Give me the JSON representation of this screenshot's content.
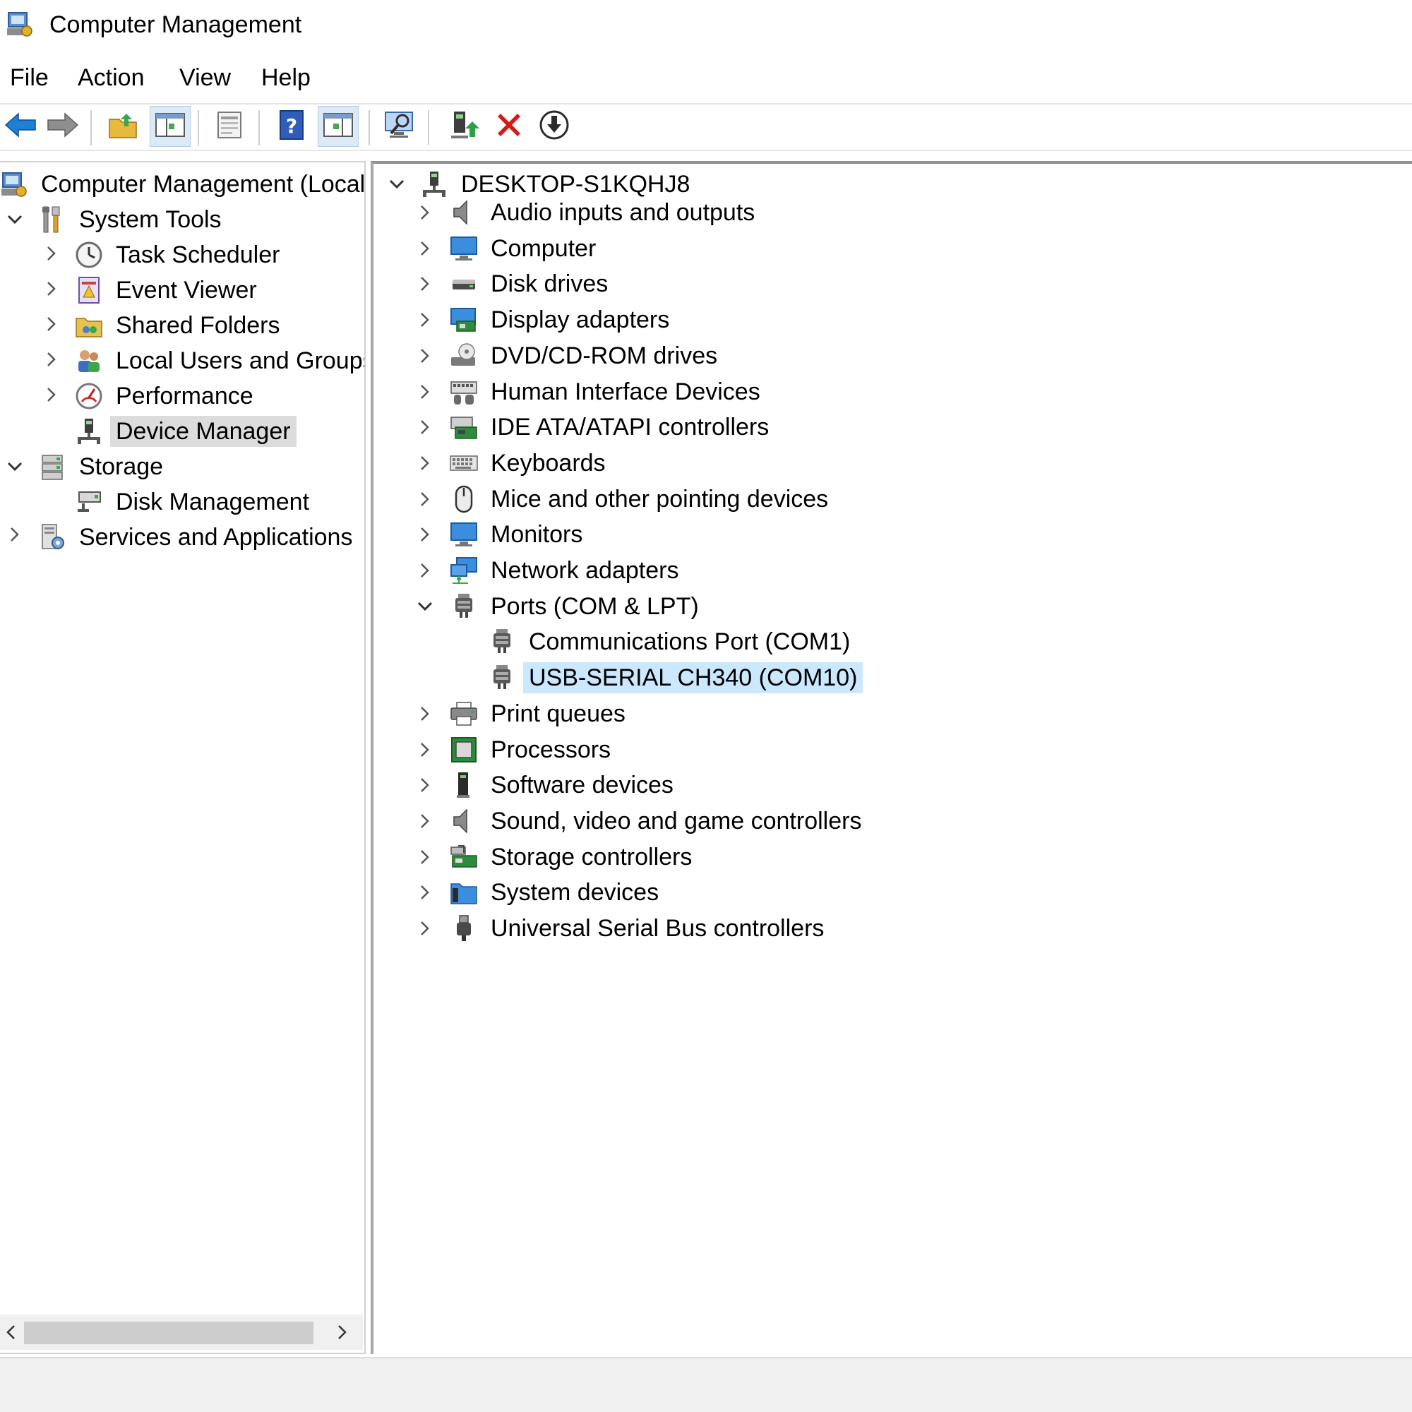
{
  "window": {
    "title": "Computer Management",
    "icon": "computer-management-icon"
  },
  "menu": {
    "file": "File",
    "action": "Action",
    "view": "View",
    "help": "Help"
  },
  "toolbar": {
    "buttons": [
      "back-arrow-icon",
      "forward-arrow-icon",
      "up-folder-icon",
      "show-console-tree-icon",
      "properties-icon",
      "help-icon",
      "show-action-pane-icon",
      "scan-hardware-icon",
      "enable-device-icon",
      "uninstall-device-icon",
      "update-driver-icon"
    ],
    "accent_back": "#1e7fd6",
    "uninstall_color": "#d7191c"
  },
  "tree": {
    "root": "Computer Management (Local",
    "system_tools": "System Tools",
    "task_scheduler": "Task Scheduler",
    "event_viewer": "Event Viewer",
    "shared_folders": "Shared Folders",
    "local_users": "Local Users and Groups",
    "performance": "Performance",
    "device_manager": "Device Manager",
    "storage": "Storage",
    "disk_management": "Disk Management",
    "services": "Services and Applications"
  },
  "devices": {
    "computer_name": "DESKTOP-S1KQHJ8",
    "categories": [
      "Audio inputs and outputs",
      "Computer",
      "Disk drives",
      "Display adapters",
      "DVD/CD-ROM drives",
      "Human Interface Devices",
      "IDE ATA/ATAPI controllers",
      "Keyboards",
      "Mice and other pointing devices",
      "Monitors",
      "Network adapters",
      "Ports (COM & LPT)",
      "Print queues",
      "Processors",
      "Software devices",
      "Sound, video and game controllers",
      "Storage controllers",
      "System devices",
      "Universal Serial Bus controllers"
    ],
    "ports_children": [
      "Communications Port (COM1)",
      "USB-SERIAL CH340 (COM10)"
    ],
    "selected_device": "USB-SERIAL CH340 (COM10)",
    "selection_color": "#cce8ff"
  }
}
